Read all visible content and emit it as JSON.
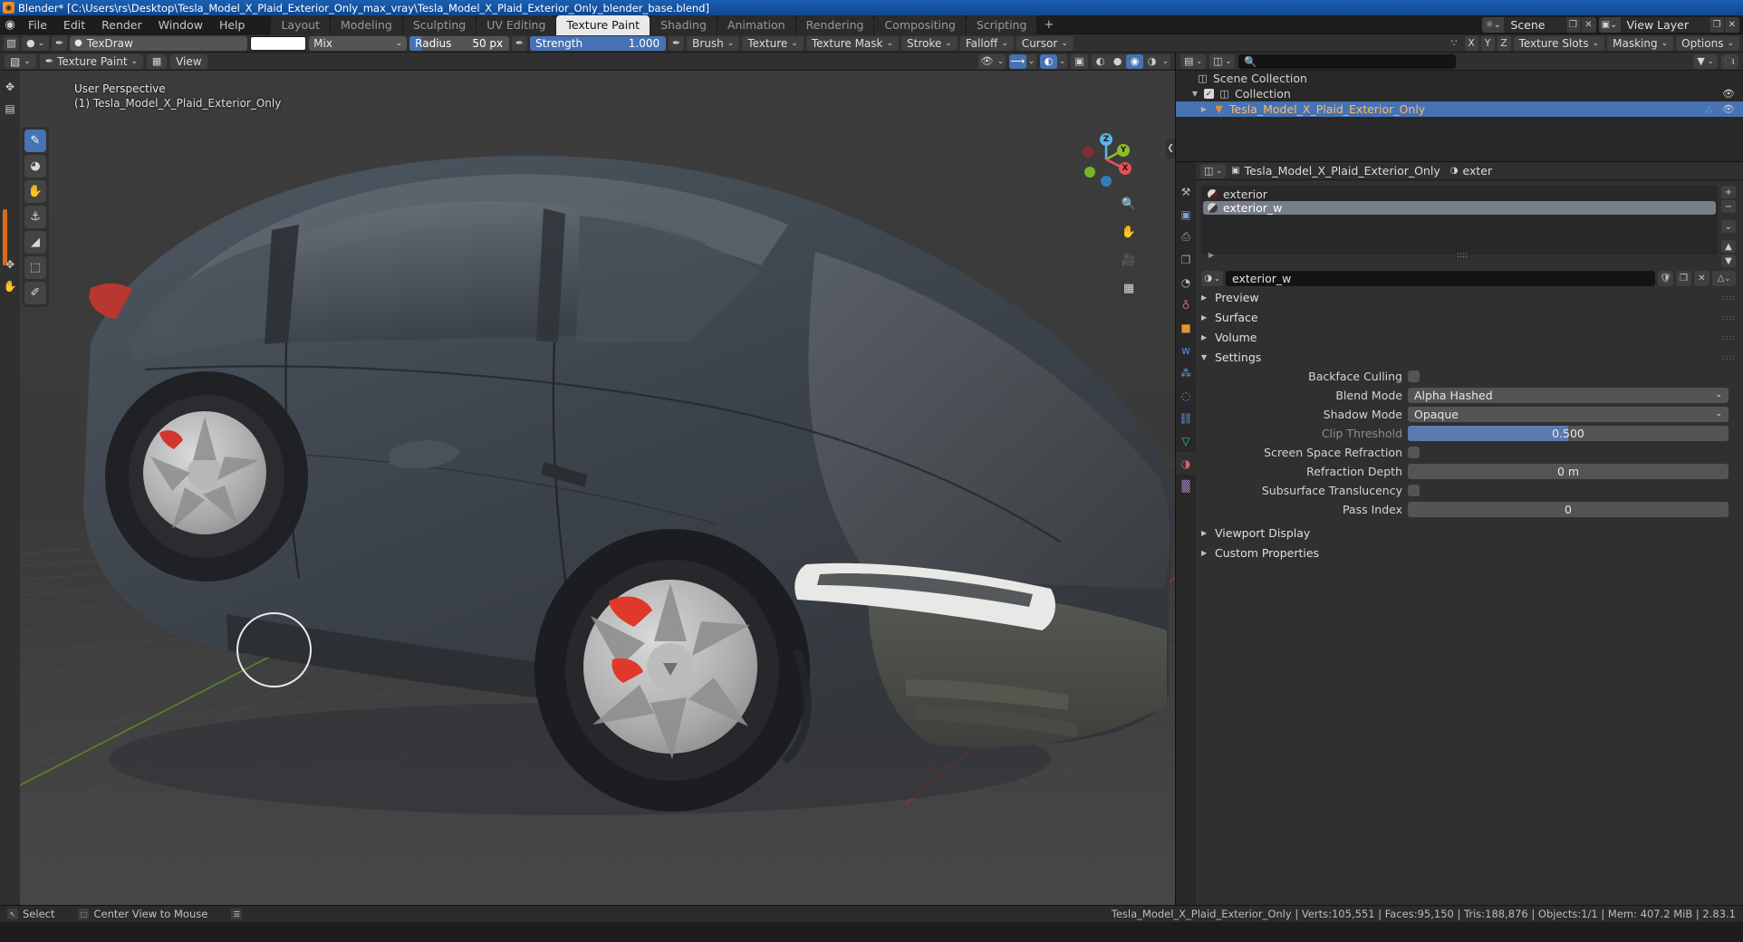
{
  "titlebar": {
    "app_icon": "blender-logo",
    "text": "Blender* [C:\\Users\\rs\\Desktop\\Tesla_Model_X_Plaid_Exterior_Only_max_vray\\Tesla_Model_X_Plaid_Exterior_Only_blender_base.blend]"
  },
  "topbar": {
    "menus": [
      "File",
      "Edit",
      "Render",
      "Window",
      "Help"
    ],
    "workspaces": [
      {
        "label": "Layout",
        "active": false
      },
      {
        "label": "Modeling",
        "active": false
      },
      {
        "label": "Sculpting",
        "active": false
      },
      {
        "label": "UV Editing",
        "active": false
      },
      {
        "label": "Texture Paint",
        "active": true
      },
      {
        "label": "Shading",
        "active": false
      },
      {
        "label": "Animation",
        "active": false
      },
      {
        "label": "Rendering",
        "active": false
      },
      {
        "label": "Compositing",
        "active": false
      },
      {
        "label": "Scripting",
        "active": false
      }
    ],
    "add_workspace": "+",
    "scene": {
      "name": "Scene",
      "new_btn": "❐",
      "unlink_btn": "✕"
    },
    "view_layer": {
      "name": "View Layer",
      "new_btn": "❐",
      "unlink_btn": "✕"
    }
  },
  "tool_settings": {
    "mode_icon": "paint-mode-icon",
    "brush_preset_icon": "brush-data-icon",
    "brush_icon": "brush-icon",
    "brush_name": "TexDraw",
    "color_swatch": "#ffffff",
    "blend_mode": "Mix",
    "radius_label": "Radius",
    "radius_value": "50 px",
    "radius_fill_pct": 12,
    "radius_pressure_icon": "pressure-icon",
    "strength_label": "Strength",
    "strength_value": "1.000",
    "strength_fill_pct": 100,
    "strength_pressure_icon": "pressure-icon",
    "popovers": [
      "Brush",
      "Texture",
      "Texture Mask",
      "Stroke",
      "Falloff",
      "Cursor"
    ],
    "symmetry_icon": "symmetry-icon",
    "axes": [
      "X",
      "Y",
      "Z"
    ],
    "texture_slots": "Texture Slots",
    "masking": "Masking",
    "options": "Options"
  },
  "viewport_header": {
    "mode": "Texture Paint",
    "menus": [
      "View"
    ],
    "mesh_icon": "mesh-select-icon",
    "visibility_icon": "visibility-icon",
    "gizmo_icon": "gizmo-icon",
    "overlays_icon": "overlays-icon",
    "xray_icon": "xray-icon",
    "shading_modes": [
      "wireframe",
      "solid",
      "material-preview",
      "rendered"
    ],
    "shading_active_index": 2
  },
  "viewport": {
    "perspective_label": "User Perspective",
    "scene_label": "(1) Tesla_Model_X_Plaid_Exterior_Only",
    "gizmo_axes": [
      {
        "label": "Z",
        "color": "#5ab4e6"
      },
      {
        "label": "Y",
        "color": "#8fbc2e"
      },
      {
        "label": "X",
        "color": "#e84f56"
      }
    ],
    "nav_buttons": [
      "zoom-icon",
      "pan-icon",
      "camera-icon",
      "ortho-persp-icon"
    ],
    "tools": [
      {
        "name": "draw-tool",
        "glyph": "✎",
        "active": true
      },
      {
        "name": "soften-tool",
        "glyph": "◕",
        "active": false
      },
      {
        "name": "smear-tool",
        "glyph": "✋",
        "active": false
      },
      {
        "name": "clone-tool",
        "glyph": "⚓",
        "active": false
      },
      {
        "name": "fill-tool",
        "glyph": "◢",
        "active": false
      },
      {
        "name": "mask-tool",
        "glyph": "⬚",
        "active": false
      },
      {
        "name": "annotate-tool",
        "glyph": "✐",
        "active": false
      }
    ]
  },
  "outliner": {
    "display_mode_icon": "outliner-display-icon",
    "filter_icon": "filter-icon",
    "search_placeholder": "",
    "search_icon": "search-icon",
    "rows": [
      {
        "label": "Scene Collection",
        "icon": "collection-icon",
        "indent": 0,
        "disclosure": "",
        "checkbox": false,
        "eye": false,
        "selected": false
      },
      {
        "label": "Collection",
        "icon": "collection-icon",
        "indent": 1,
        "disclosure": "▼",
        "checkbox": true,
        "eye": true,
        "selected": false
      },
      {
        "label": "Tesla_Model_X_Plaid_Exterior_Only",
        "icon": "mesh-object-icon",
        "indent": 2,
        "disclosure": "▶",
        "checkbox": false,
        "eye": true,
        "selected": true,
        "data_icon": "mesh-data-icon"
      }
    ]
  },
  "properties": {
    "editor_type_icon": "properties-editor-icon",
    "breadcrumb": {
      "object_icon": "object-icon",
      "object": "Tesla_Model_X_Plaid_Exterior_Only",
      "material_icon": "material-icon",
      "material": "exter"
    },
    "nav_tabs": [
      {
        "name": "tool-tab",
        "glyph": "⚒",
        "active": false
      },
      {
        "name": "render-tab",
        "glyph": "▣",
        "active": false
      },
      {
        "name": "output-tab",
        "glyph": "⎙",
        "active": false
      },
      {
        "name": "view-layer-tab",
        "glyph": "❐",
        "active": false
      },
      {
        "name": "scene-tab",
        "glyph": "◔",
        "active": false
      },
      {
        "name": "world-tab",
        "glyph": "♁",
        "active": false
      },
      {
        "name": "object-tab",
        "glyph": "■",
        "active": false
      },
      {
        "name": "modifier-tab",
        "glyph": "ᴡ",
        "active": false
      },
      {
        "name": "particles-tab",
        "glyph": "⁂",
        "active": false
      },
      {
        "name": "physics-tab",
        "glyph": "◌",
        "active": false
      },
      {
        "name": "constraints-tab",
        "glyph": "⛓",
        "active": false
      },
      {
        "name": "object-data-tab",
        "glyph": "▽",
        "active": false
      },
      {
        "name": "material-tab",
        "glyph": "◑",
        "active": true
      },
      {
        "name": "texture-tab",
        "glyph": "▒",
        "active": false
      }
    ],
    "material_slots": [
      {
        "name": "exterior",
        "selected": false,
        "preview": "red"
      },
      {
        "name": "exterior_w",
        "selected": true,
        "preview": "grey"
      }
    ],
    "slot_buttons": [
      "+",
      "−",
      "⌄"
    ],
    "slot_scroll": [
      "▲",
      "▼"
    ],
    "active_material": {
      "browse_icon": "material-browse-icon",
      "name": "exterior_w",
      "fake_user_icon": "shield-icon",
      "copy_icon": "copy-icon",
      "unlink_icon": "unlink-icon",
      "node_icon": "node-icon"
    },
    "panels": [
      {
        "label": "Preview",
        "open": false
      },
      {
        "label": "Surface",
        "open": false
      },
      {
        "label": "Volume",
        "open": false
      },
      {
        "label": "Settings",
        "open": true
      }
    ],
    "settings": [
      {
        "label": "Backface Culling",
        "type": "checkbox",
        "value": false,
        "dim": false
      },
      {
        "label": "Blend Mode",
        "type": "dropdown",
        "value": "Alpha Hashed",
        "dim": false
      },
      {
        "label": "Shadow Mode",
        "type": "dropdown",
        "value": "Opaque",
        "dim": false
      },
      {
        "label": "Clip Threshold",
        "type": "slider",
        "value": "0.500",
        "fill_pct": 50,
        "dim": true
      },
      {
        "label": "Screen Space Refraction",
        "type": "checkbox",
        "value": false,
        "dim": false
      },
      {
        "label": "Refraction Depth",
        "type": "value",
        "value": "0 m",
        "dim": false
      },
      {
        "label": "Subsurface Translucency",
        "type": "checkbox",
        "value": false,
        "dim": false
      },
      {
        "label": "Pass Index",
        "type": "value",
        "value": "0",
        "dim": false
      }
    ],
    "extra_panels": [
      {
        "label": "Viewport Display",
        "open": false
      },
      {
        "label": "Custom Properties",
        "open": false
      }
    ]
  },
  "statusbar": {
    "left": [
      {
        "key": "↖",
        "label": "Select"
      },
      {
        "key": "⬚",
        "label": "Center View to Mouse"
      },
      {
        "key": "☰",
        "label": ""
      }
    ],
    "right": "Tesla_Model_X_Plaid_Exterior_Only  |  Verts:105,551  |  Faces:95,150  |  Tris:188,876  |  Objects:1/1  |  Mem: 407.2 MiB  |  2.83.1"
  },
  "colors": {
    "accent_blue": "#4772b3",
    "selected_orange": "#ffb964",
    "panel_bg": "#303030",
    "editor_bg": "#282828",
    "viewport_bg": "#3a3a3a"
  }
}
